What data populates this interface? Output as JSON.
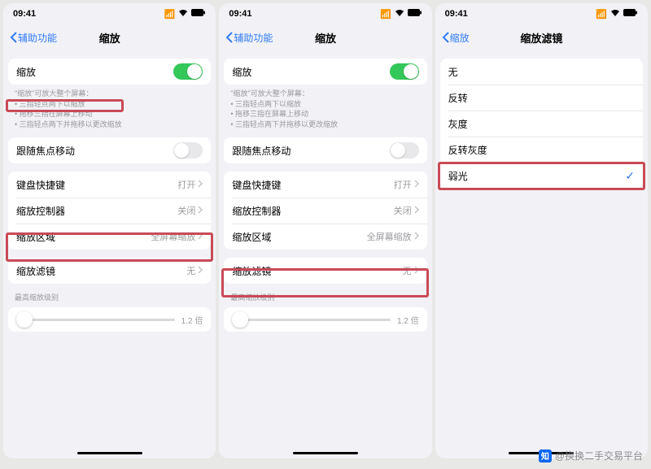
{
  "status": {
    "time": "09:41",
    "signal": "▪▪▪▪",
    "wifi": "✓",
    "battery": "■"
  },
  "phone1": {
    "back": "辅助功能",
    "title": "缩放",
    "rows": {
      "zoom": "缩放",
      "follow": "跟随焦点移动",
      "kb": "键盘快捷键",
      "kb_v": "打开",
      "ctrl": "缩放控制器",
      "ctrl_v": "关闭",
      "region": "缩放区域",
      "region_v": "全屏幕缩放",
      "filter": "缩放滤镜",
      "filter_v": "无",
      "max": "最高缩放级别",
      "slider_v": "1.2 倍"
    },
    "hint": {
      "l1": "\"缩放\"可放大整个屏幕：",
      "b1": "三指轻点两下以缩放",
      "b2": "拖移三指在屏幕上移动",
      "b3": "三指轻点两下并拖移以更改缩放"
    }
  },
  "phone2": {
    "back": "辅助功能",
    "title": "缩放",
    "rows": {
      "zoom": "缩放",
      "follow": "跟随焦点移动",
      "kb": "键盘快捷键",
      "kb_v": "打开",
      "ctrl": "缩放控制器",
      "ctrl_v": "关闭",
      "region": "缩放区域",
      "region_v": "全屏幕缩放",
      "filter": "缩放滤镜",
      "filter_v": "无",
      "max": "最高缩放级别",
      "slider_v": "1.2 倍"
    },
    "hint": {
      "l1": "\"缩放\"可放大整个屏幕：",
      "b1": "三指轻点两下以缩放",
      "b2": "拖移三指在屏幕上移动",
      "b3": "三指轻点两下并拖移以更改缩放"
    }
  },
  "phone3": {
    "back": "缩放",
    "title": "缩放滤镜",
    "options": {
      "o1": "无",
      "o2": "反转",
      "o3": "灰度",
      "o4": "反转灰度",
      "o5": "弱光"
    }
  },
  "watermark": "@换换二手交易平台",
  "zh_logo": "知乎"
}
